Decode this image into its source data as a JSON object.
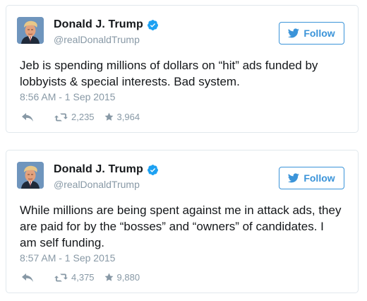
{
  "colors": {
    "accent": "#3b94d9",
    "verified": "#1da1f2",
    "secondary_text": "#8899a6",
    "primary_text": "#14171a",
    "card_border": "#e1e8ed"
  },
  "icons": {
    "verified": "verified-badge-icon",
    "follow": "twitter-bird-icon",
    "reply": "reply-arrow-icon",
    "retweet": "retweet-icon",
    "like": "star-icon"
  },
  "tweets": [
    {
      "author": {
        "name": "Donald J. Trump",
        "handle": "@realDonaldTrump",
        "verified": true
      },
      "follow_label": "Follow",
      "text": "Jeb is spending millions of dollars on “hit” ads funded by lobbyists & special interests. Bad system.",
      "timestamp": "8:56 AM - 1 Sep 2015",
      "retweets": "2,235",
      "likes": "3,964"
    },
    {
      "author": {
        "name": "Donald J. Trump",
        "handle": "@realDonaldTrump",
        "verified": true
      },
      "follow_label": "Follow",
      "text": "While millions are being spent against me in attack ads, they are paid for by the “bosses” and “owners” of candidates. I am self funding.",
      "timestamp": "8:57 AM - 1 Sep 2015",
      "retweets": "4,375",
      "likes": "9,880"
    }
  ]
}
